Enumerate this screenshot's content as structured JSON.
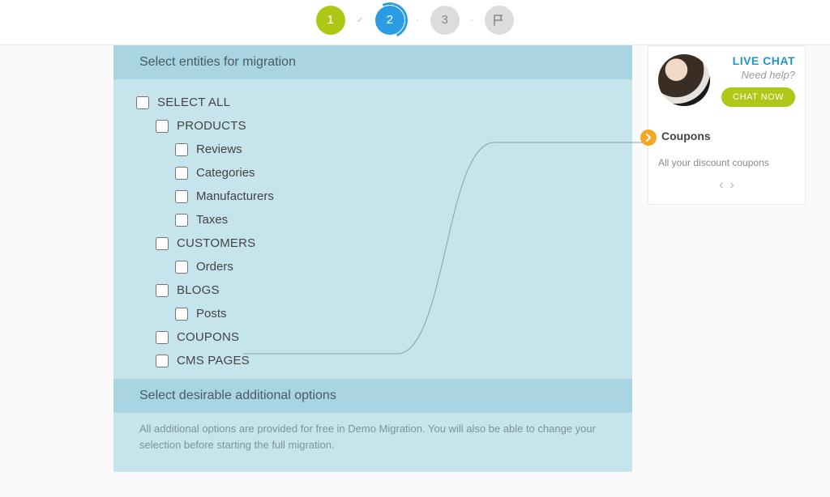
{
  "stepper": {
    "step1": "1",
    "step2": "2",
    "step3": "3"
  },
  "sections": {
    "entities_header": "Select entities for migration",
    "options_header": "Select desirable additional options",
    "options_note": "All additional options are provided for free in Demo Migration. You will also be able to change your selection before starting the full migration."
  },
  "tree": {
    "select_all": "SELECT ALL",
    "products": "PRODUCTS",
    "reviews": "Reviews",
    "categories": "Categories",
    "manufacturers": "Manufacturers",
    "taxes": "Taxes",
    "customers": "CUSTOMERS",
    "orders": "Orders",
    "blogs": "BLOGS",
    "posts": "Posts",
    "coupons": "COUPONS",
    "cms_pages": "CMS PAGES"
  },
  "sidebar": {
    "chat_title": "LIVE CHAT",
    "chat_sub": "Need help?",
    "chat_btn": "CHAT NOW",
    "info_title": "Coupons",
    "info_desc": "All your discount coupons"
  }
}
